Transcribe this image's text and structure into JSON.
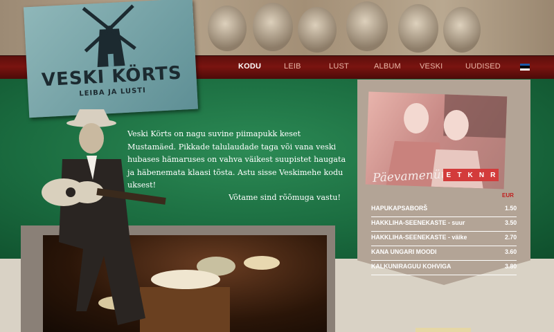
{
  "logo": {
    "title": "VESKI KÖRTS",
    "subtitle": "LEIBA JA LUSTI"
  },
  "nav": {
    "items": [
      "KODU",
      "LEIB",
      "LUST",
      "ALBUM",
      "VESKI",
      "UUDISED"
    ],
    "active": "KODU",
    "language_flag": "estonian-flag-icon",
    "flag_colors": [
      "#1d5aa8",
      "#000000",
      "#ffffff"
    ]
  },
  "intro": {
    "text": "Veski Körts on nagu suvine piimapukk keset Mustamäed. Pikkade talulaudade taga või vana veski hubases hämaruses on vahva väikest suupistet haugata ja häbenemata klaasi tõsta. Astu sisse Veskimehe kodu uksest!",
    "welcome": "Võtame sind rõõmuga vastu!"
  },
  "daily_menu": {
    "title": "Päevamenüü",
    "days": [
      "E",
      "T",
      "K",
      "N",
      "R"
    ],
    "currency": "EUR",
    "dishes": [
      {
        "name": "HAPUKAPSABORŠ",
        "price": "1.50"
      },
      {
        "name": "HAKKLIHA-SEENEKASTE  - suur",
        "price": "3.50"
      },
      {
        "name": "HAKKLIHA-SEENEKASTE    - väike",
        "price": "2.70"
      },
      {
        "name": "KANA UNGARI MOODI",
        "price": "3.60"
      },
      {
        "name": "KALKUNIRAGUU KOHVIGA",
        "price": "3.80"
      }
    ]
  },
  "colors": {
    "nav_red": "#7a1410",
    "green": "#1a6b3f",
    "day_tab_red": "#d33b3b",
    "accent_red": "#c11c1c"
  }
}
